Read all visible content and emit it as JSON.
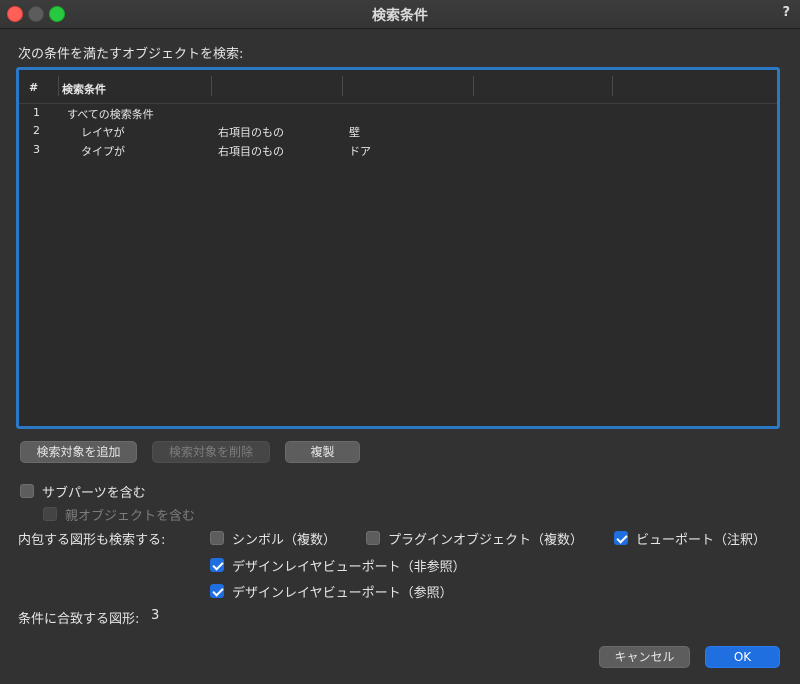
{
  "window": {
    "title": "検索条件",
    "help": "?"
  },
  "prompt": "次の条件を満たすオブジェクトを検索:",
  "table": {
    "columns": [
      "#",
      "検索条件",
      "",
      "",
      "",
      ""
    ],
    "rows": [
      {
        "num": "1",
        "c1": "すべての検索条件",
        "c2": "",
        "c3": ""
      },
      {
        "num": "2",
        "c1": "レイヤが",
        "c2": "右項目のもの",
        "c3": "壁"
      },
      {
        "num": "3",
        "c1": "タイプが",
        "c2": "右項目のもの",
        "c3": "ドア"
      }
    ]
  },
  "buttons": {
    "add": "検索対象を追加",
    "remove": "検索対象を削除",
    "duplicate": "複製",
    "cancel": "キャンセル",
    "ok": "OK"
  },
  "options": {
    "include_subparts": {
      "label": "サブパーツを含む",
      "checked": false
    },
    "include_parent": {
      "label": "親オブジェクトを含む",
      "checked": false,
      "disabled": true
    },
    "nested_label": "内包する図形も検索する:",
    "symbols": {
      "label": "シンボル（複数）",
      "checked": false
    },
    "plugin_objects": {
      "label": "プラグインオブジェクト（複数）",
      "checked": false
    },
    "viewport_annot": {
      "label": "ビューポート（注釈）",
      "checked": true
    },
    "design_layer_nonref": {
      "label": "デザインレイヤビューポート（非参照）",
      "checked": true
    },
    "design_layer_ref": {
      "label": "デザインレイヤビューポート（参照）",
      "checked": true
    }
  },
  "match_count": {
    "label": "条件に合致する図形:",
    "value": "3"
  },
  "colors": {
    "accent": "#1f6fe0",
    "frame": "#2b79c4",
    "background": "#323232"
  }
}
